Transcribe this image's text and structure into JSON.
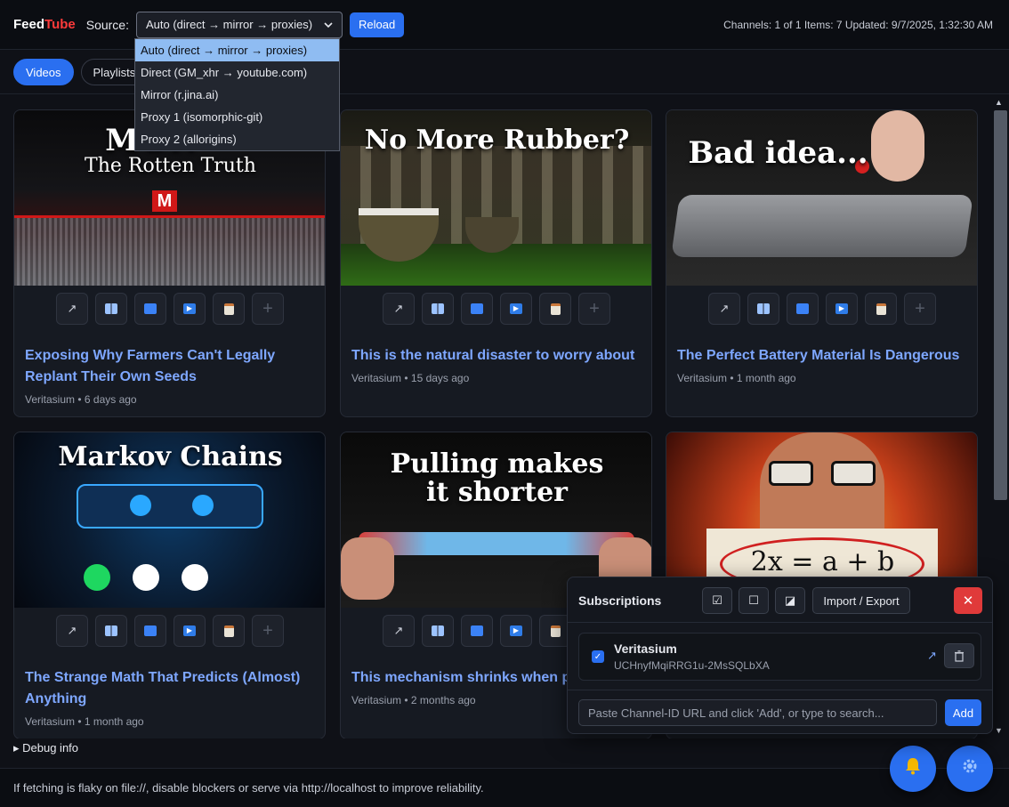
{
  "header": {
    "logo_feed": "Feed",
    "logo_tube": "Tube",
    "source_label": "Source:",
    "source_value": "Auto (direct → mirror → proxies)",
    "reload_label": "Reload",
    "status": "Channels: 1 of 1 Items: 7 Updated: 9/7/2025, 1:32:30 AM"
  },
  "source_options": [
    "Auto (direct → mirror → proxies)",
    "Direct (GM_xhr → youtube.com)",
    "Mirror (r.jina.ai)",
    "Proxy 1 (isomorphic-git)",
    "Proxy 2 (allorigins)"
  ],
  "tabs": [
    "Videos",
    "Playlists"
  ],
  "videos": [
    {
      "title": "Exposing Why Farmers Can't Legally Replant Their Own Seeds",
      "meta": "Veritasium • 6 days ago",
      "thumb_text": "MON    ",
      "thumb_sub": "The Rotten Truth"
    },
    {
      "title": "This is the natural disaster to worry about",
      "meta": "Veritasium • 15 days ago",
      "thumb_text": "No More Rubber?",
      "thumb_sub": ""
    },
    {
      "title": "The Perfect Battery Material Is Dangerous",
      "meta": "Veritasium • 1 month ago",
      "thumb_text": "Bad idea...",
      "thumb_sub": ""
    },
    {
      "title": "The Strange Math That Predicts (Almost) Anything",
      "meta": "Veritasium • 1 month ago",
      "thumb_text": "Markov Chains",
      "thumb_sub": ""
    },
    {
      "title": "This mechanism shrinks when pu",
      "meta": "Veritasium • 2 months ago",
      "thumb_text": "Pulling makes",
      "thumb_sub": "it shorter"
    },
    {
      "title": "",
      "meta": "",
      "thumb_text": "2x = a + b",
      "thumb_sub": ""
    }
  ],
  "action_icons": [
    "↗",
    "⊞",
    "▭",
    "▶",
    "📋",
    "+"
  ],
  "debug_label": "▸ Debug info",
  "footer_text": "If fetching is flaky on file://, disable blockers or serve via http://localhost to improve reliability.",
  "subscriptions": {
    "title": "Subscriptions",
    "check_all_icon": "☑",
    "uncheck_all_icon": "☐",
    "invert_icon": "◪",
    "import_export_label": "Import / Export",
    "close_icon": "✕",
    "items": [
      {
        "name": "Veritasium",
        "id": "UCHnyfMqiRRG1u-2MsSQLbXA"
      }
    ],
    "input_placeholder": "Paste Channel-ID URL and click 'Add', or type to search...",
    "add_label": "Add"
  },
  "colors": {
    "accent": "#2a6ff0",
    "link": "#7ea7ff",
    "danger": "#e03a3a",
    "brand_red": "#ff3b3b"
  }
}
